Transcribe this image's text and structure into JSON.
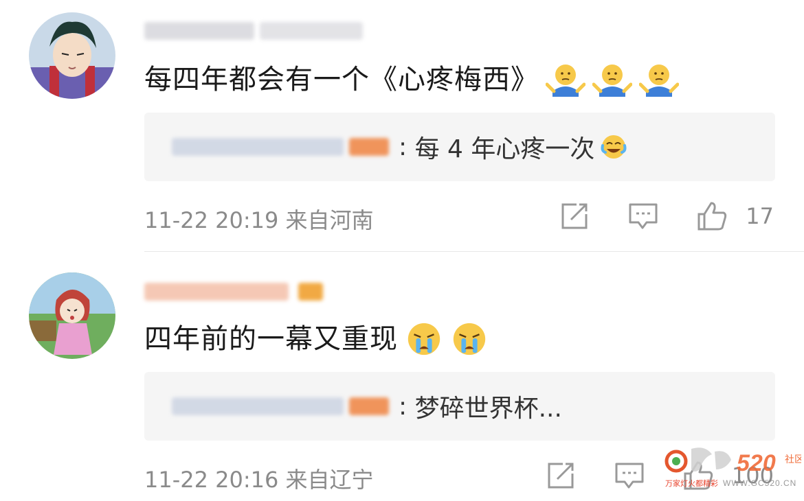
{
  "comments": [
    {
      "text": "每四年都会有一个《心疼梅西》",
      "emoji_names": [
        "shrug-emoji",
        "shrug-emoji",
        "shrug-emoji"
      ],
      "reply_text": "每 4 年心疼一次",
      "reply_emoji": "laugh-cry-emoji",
      "meta": "11-22 20:19 来自河南",
      "likes": "17"
    },
    {
      "text": "四年前的一幕又重现",
      "emoji_names": [
        "crying-emoji",
        "crying-emoji"
      ],
      "reply_text": "梦碎世界杯...",
      "meta": "11-22 20:16 来自辽宁",
      "likes": "100"
    }
  ],
  "colors": {
    "reply_bg": "#f5f5f5",
    "meta_gray": "#8a8a8a",
    "badge_orange": "#f08a4b",
    "crown_orange": "#f0a030"
  },
  "watermark": {
    "brand": "520",
    "side_text": "社区",
    "site": "WWW.GC520.CN",
    "tagline": "万家灯火都精彩"
  }
}
